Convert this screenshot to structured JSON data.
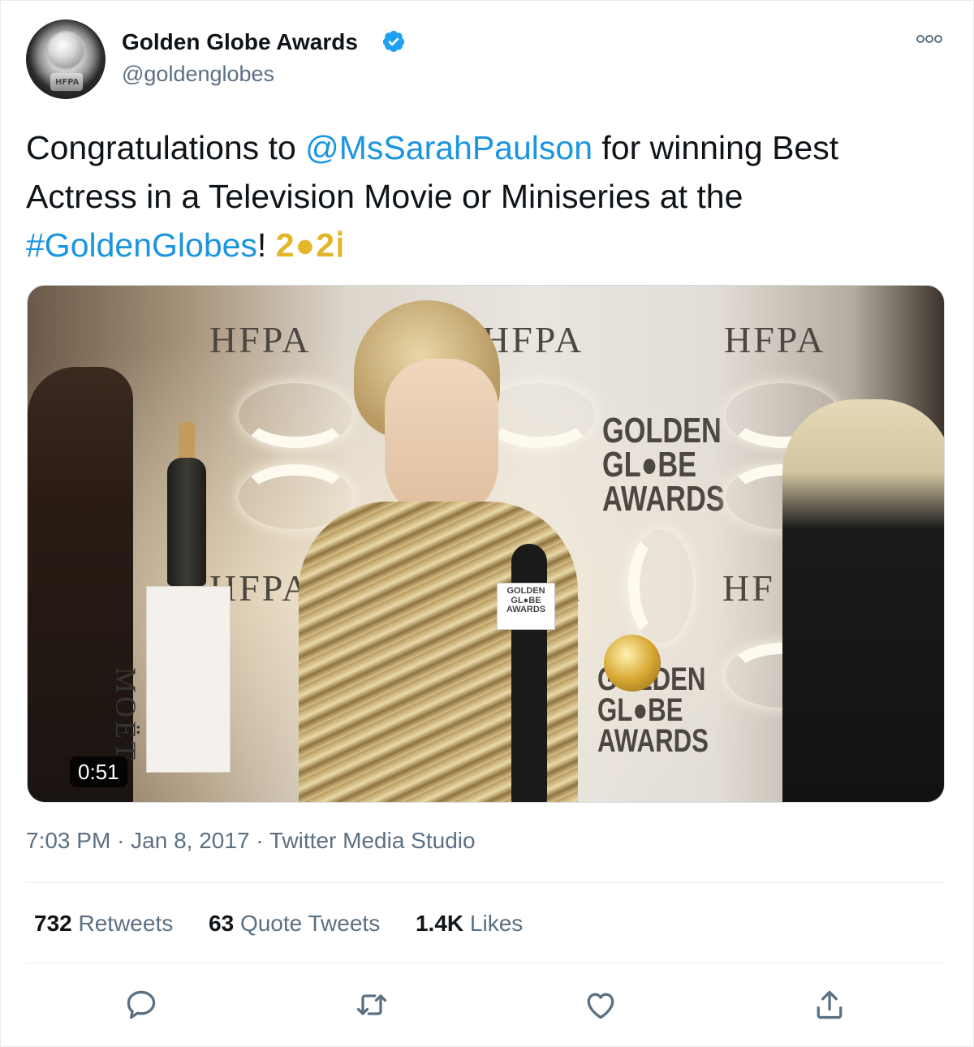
{
  "author": {
    "display_name": "Golden Globe Awards",
    "handle": "@goldenglobes",
    "verified": true,
    "avatar_label": "HFPA"
  },
  "tweet": {
    "text_prefix": "Congratulations to ",
    "mention": "@MsSarahPaulson",
    "text_middle": " for winning Best Actress in a Television Movie or Miniseries at the ",
    "hashtag": "#GoldenGlobes",
    "text_suffix": "! ",
    "emoji": "2●2𝗂"
  },
  "media": {
    "duration": "0:51",
    "wall_labels": [
      "HFPA",
      "HFPA",
      "HFPA",
      "HFPA",
      "PA",
      "HF"
    ],
    "gg_label_lines": [
      "GOLDEN",
      "GL●BE",
      "AWARDS"
    ],
    "sponsor_label": "MOËT"
  },
  "meta": {
    "time": "7:03 PM",
    "date": "Jan 8, 2017",
    "source": "Twitter Media Studio",
    "separator": "·"
  },
  "stats": [
    {
      "count": "732",
      "label": "Retweets"
    },
    {
      "count": "63",
      "label": "Quote Tweets"
    },
    {
      "count": "1.4K",
      "label": "Likes"
    }
  ],
  "actions": {
    "reply_icon": "reply-icon",
    "retweet_icon": "retweet-icon",
    "like_icon": "like-icon",
    "share_icon": "share-icon"
  },
  "colors": {
    "link": "#1b95e0",
    "secondary_text": "#5b7083",
    "verified": "#1da1f2",
    "divider": "#e6ecf0"
  }
}
